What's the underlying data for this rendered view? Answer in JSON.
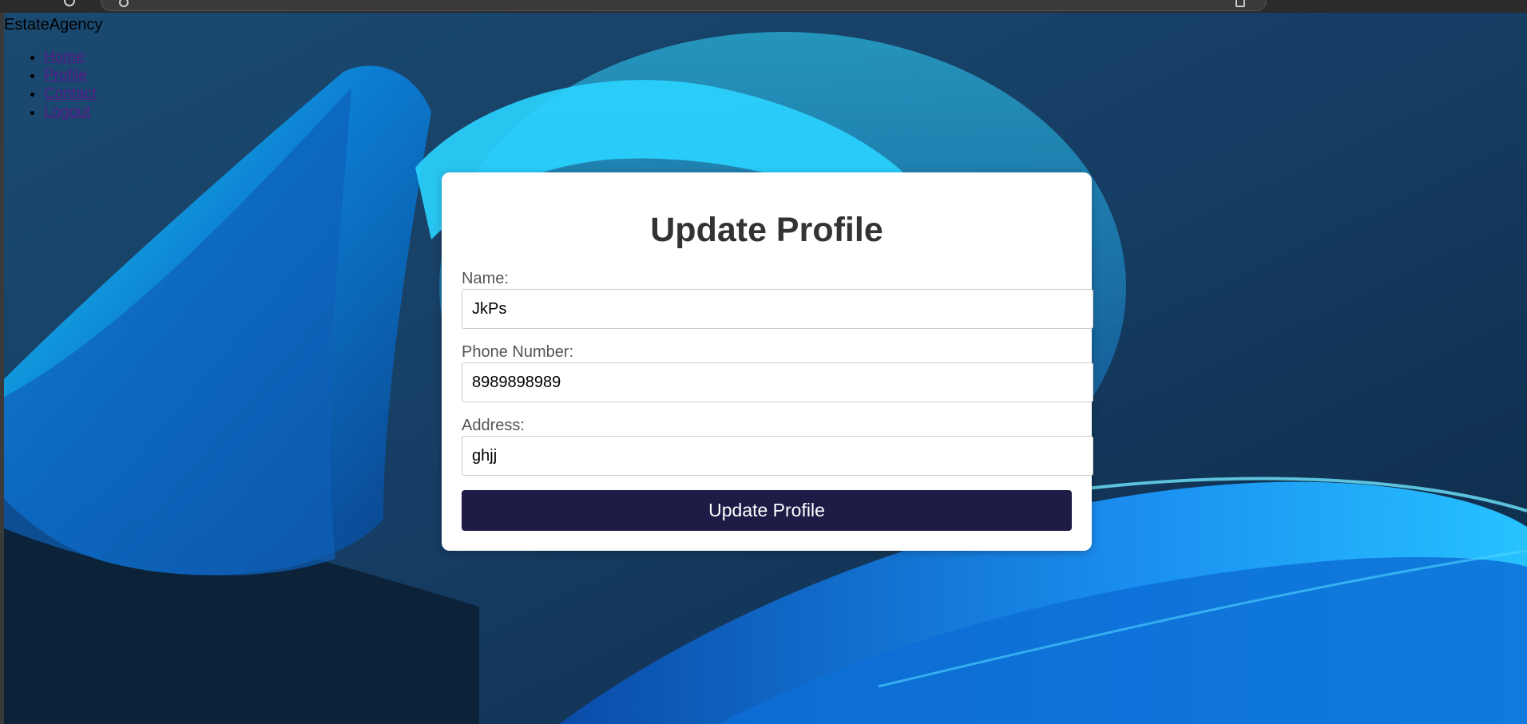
{
  "nav": {
    "brand": "EstateAgency",
    "links": [
      {
        "label": "Home"
      },
      {
        "label": "Profile"
      },
      {
        "label": "Contact"
      },
      {
        "label": "Logout"
      }
    ]
  },
  "form": {
    "title": "Update Profile",
    "fields": [
      {
        "label": "Name:",
        "value": "JkPs"
      },
      {
        "label": "Phone Number:",
        "value": "8989898989"
      },
      {
        "label": "Address:",
        "value": "ghjj"
      }
    ],
    "submit_label": "Update Profile"
  },
  "colors": {
    "button_bg": "#1e1b47",
    "link": "#551a8b",
    "card_bg": "#ffffff",
    "wallpaper_base": "#133a5e",
    "wallpaper_accent": "#1ec8ff"
  },
  "icons": {
    "browser_toolbar": [
      "reload-icon",
      "site-info-icon",
      "bookmark-star-icon"
    ]
  }
}
